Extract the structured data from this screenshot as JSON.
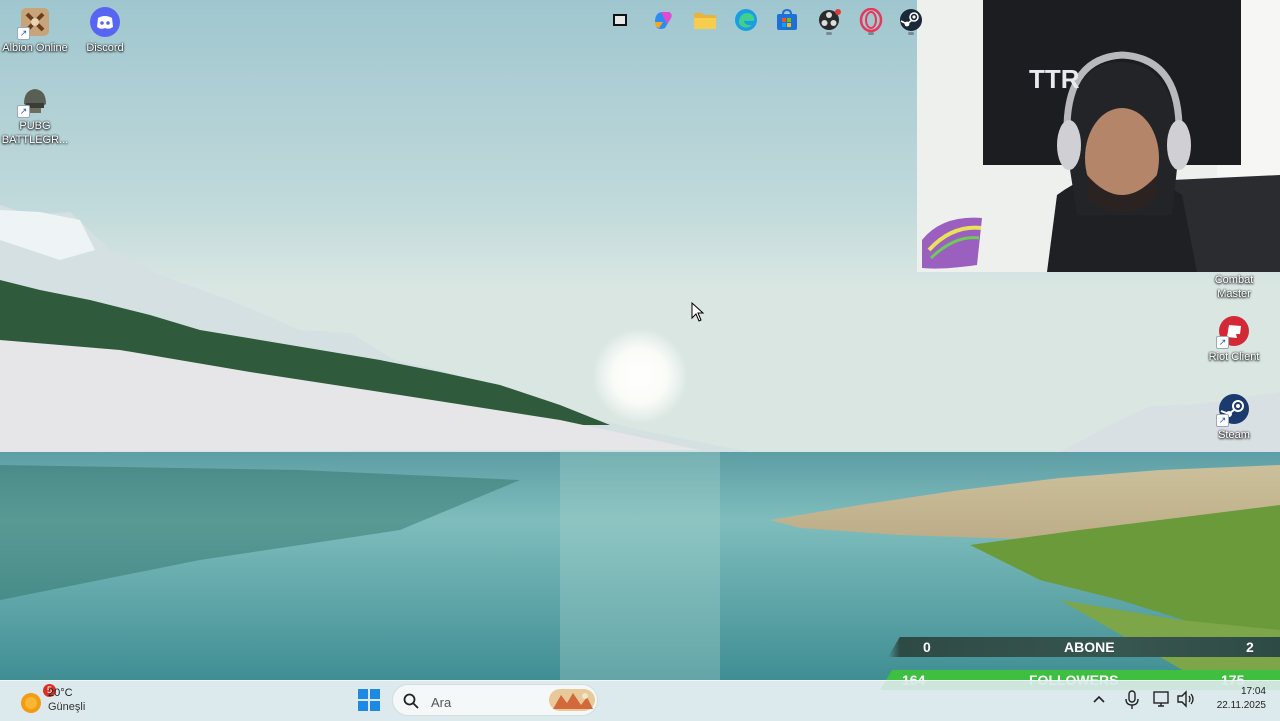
{
  "desktop": {
    "left_icons": [
      {
        "name": "albion-online",
        "label": "Albion Online"
      },
      {
        "name": "discord",
        "label": "Discord"
      },
      {
        "name": "pubg",
        "label": "PUBG BATTLEGR..."
      }
    ],
    "right_icons": [
      {
        "name": "combat-master",
        "label": "Combat Master"
      },
      {
        "name": "riot-client",
        "label": "Riot Client"
      },
      {
        "name": "steam",
        "label": "Steam"
      }
    ]
  },
  "stream_overlay": {
    "abone": {
      "left_value": "0",
      "label": "ABONE",
      "right_value": "2"
    },
    "followers": {
      "left_value": "164",
      "label": "FOLLOWERS",
      "right_value": "175"
    },
    "colors": {
      "abone_bar": "#37564f",
      "followers_bar": "#3fbf3f"
    }
  },
  "webcam": {
    "banner_text": "TTR"
  },
  "taskbar": {
    "weather": {
      "temperature": "20°C",
      "condition": "Güneşli",
      "badge": "5"
    },
    "search": {
      "placeholder": "Ara"
    },
    "pinned_icons": [
      "windows-start-icon",
      "search-icon",
      "task-view-icon",
      "copilot-icon",
      "file-explorer-icon",
      "edge-icon",
      "microsoft-store-icon",
      "obs-icon",
      "opera-gx-icon",
      "steam-icon"
    ],
    "tray": {
      "time": "17:04",
      "date": "22.11.2025"
    }
  }
}
